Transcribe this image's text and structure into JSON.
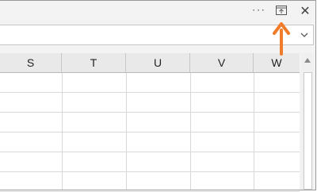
{
  "window": {
    "more_label": "···",
    "close_label": "✕",
    "restore_icon": "restore-down-icon"
  },
  "formula_bar": {
    "value": "",
    "expand_icon": "chevron-down-icon"
  },
  "grid": {
    "columns": [
      "S",
      "T",
      "U",
      "V",
      "W"
    ]
  },
  "annotation": {
    "color": "#f07c2b"
  }
}
